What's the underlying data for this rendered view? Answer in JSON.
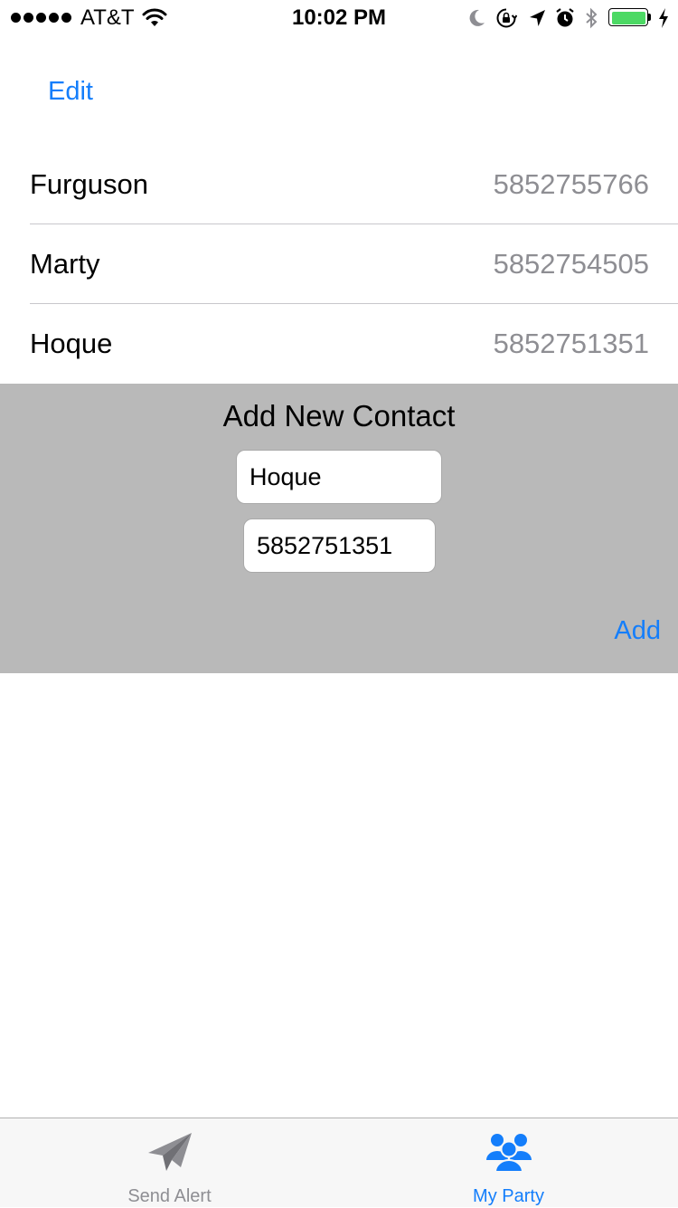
{
  "status_bar": {
    "carrier": "AT&T",
    "time": "10:02 PM",
    "signal_bars": 5,
    "battery_level": 0.92,
    "icons": [
      "signal-dots-icon",
      "wifi-icon",
      "moon-icon",
      "lock-rotation-icon",
      "location-icon",
      "alarm-icon",
      "bluetooth-icon",
      "battery-icon",
      "charging-icon"
    ]
  },
  "nav": {
    "edit_label": "Edit"
  },
  "contacts": [
    {
      "name": "Furguson",
      "phone": "5852755766"
    },
    {
      "name": "Marty",
      "phone": "5852754505"
    },
    {
      "name": "Hoque",
      "phone": "5852751351"
    }
  ],
  "add_contact": {
    "title": "Add New Contact",
    "name_value": "Hoque",
    "phone_value": "5852751351",
    "add_label": "Add"
  },
  "tab_bar": {
    "tabs": [
      {
        "label": "Send Alert",
        "icon": "paper-plane-icon",
        "selected": false
      },
      {
        "label": "My Party",
        "icon": "group-icon",
        "selected": true
      }
    ]
  },
  "colors": {
    "accent": "#147efb",
    "panel_background": "#b9b9b9",
    "secondary_text": "#8e8e93",
    "tab_inactive": "#8e8e93",
    "battery": "#4cd964"
  }
}
